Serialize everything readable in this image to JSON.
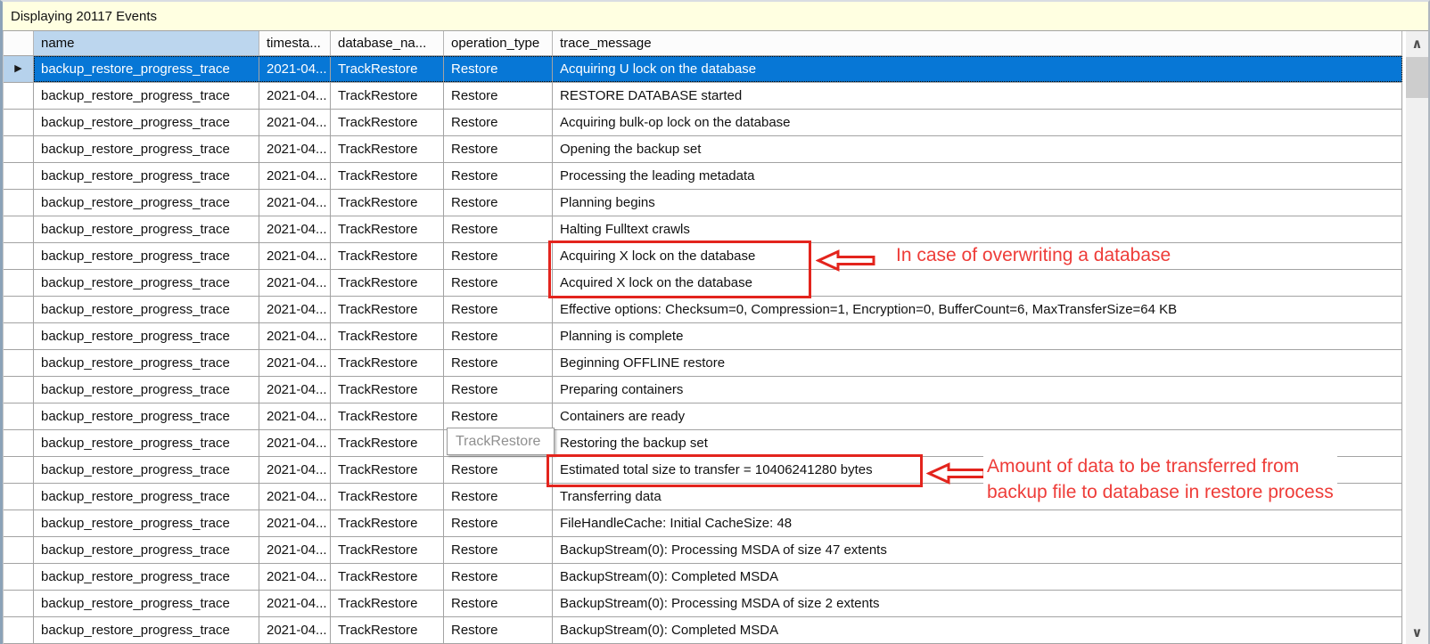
{
  "status_bar": {
    "text": "Displaying 20117 Events"
  },
  "grid": {
    "columns": [
      {
        "label": "name"
      },
      {
        "label": "timesta..."
      },
      {
        "label": "database_na..."
      },
      {
        "label": "operation_type"
      },
      {
        "label": "trace_message"
      }
    ],
    "row_marker_icon": "▶",
    "rows": [
      {
        "selected": true,
        "name": "backup_restore_progress_trace",
        "timestamp": "2021-04...",
        "database_name": "TrackRestore",
        "operation_type": "Restore",
        "trace_message": "Acquiring U lock on the database"
      },
      {
        "name": "backup_restore_progress_trace",
        "timestamp": "2021-04...",
        "database_name": "TrackRestore",
        "operation_type": "Restore",
        "trace_message": "RESTORE DATABASE started"
      },
      {
        "name": "backup_restore_progress_trace",
        "timestamp": "2021-04...",
        "database_name": "TrackRestore",
        "operation_type": "Restore",
        "trace_message": "Acquiring bulk-op lock on the database"
      },
      {
        "name": "backup_restore_progress_trace",
        "timestamp": "2021-04...",
        "database_name": "TrackRestore",
        "operation_type": "Restore",
        "trace_message": "Opening the backup set"
      },
      {
        "name": "backup_restore_progress_trace",
        "timestamp": "2021-04...",
        "database_name": "TrackRestore",
        "operation_type": "Restore",
        "trace_message": "Processing the leading metadata"
      },
      {
        "name": "backup_restore_progress_trace",
        "timestamp": "2021-04...",
        "database_name": "TrackRestore",
        "operation_type": "Restore",
        "trace_message": "Planning begins"
      },
      {
        "name": "backup_restore_progress_trace",
        "timestamp": "2021-04...",
        "database_name": "TrackRestore",
        "operation_type": "Restore",
        "trace_message": "Halting Fulltext crawls"
      },
      {
        "name": "backup_restore_progress_trace",
        "timestamp": "2021-04...",
        "database_name": "TrackRestore",
        "operation_type": "Restore",
        "trace_message": "Acquiring X lock on the database"
      },
      {
        "name": "backup_restore_progress_trace",
        "timestamp": "2021-04...",
        "database_name": "TrackRestore",
        "operation_type": "Restore",
        "trace_message": "Acquired X lock on the database"
      },
      {
        "name": "backup_restore_progress_trace",
        "timestamp": "2021-04...",
        "database_name": "TrackRestore",
        "operation_type": "Restore",
        "trace_message": "Effective options: Checksum=0, Compression=1, Encryption=0, BufferCount=6, MaxTransferSize=64 KB"
      },
      {
        "name": "backup_restore_progress_trace",
        "timestamp": "2021-04...",
        "database_name": "TrackRestore",
        "operation_type": "Restore",
        "trace_message": "Planning is complete"
      },
      {
        "name": "backup_restore_progress_trace",
        "timestamp": "2021-04...",
        "database_name": "TrackRestore",
        "operation_type": "Restore",
        "trace_message": "Beginning OFFLINE restore"
      },
      {
        "name": "backup_restore_progress_trace",
        "timestamp": "2021-04...",
        "database_name": "TrackRestore",
        "operation_type": "Restore",
        "trace_message": "Preparing containers"
      },
      {
        "name": "backup_restore_progress_trace",
        "timestamp": "2021-04...",
        "database_name": "TrackRestore",
        "operation_type": "Restore",
        "trace_message": "Containers are ready"
      },
      {
        "name": "backup_restore_progress_trace",
        "timestamp": "2021-04...",
        "database_name": "TrackRestore",
        "operation_type": "Restore",
        "trace_message": "Restoring the backup set"
      },
      {
        "name": "backup_restore_progress_trace",
        "timestamp": "2021-04...",
        "database_name": "TrackRestore",
        "operation_type": "Restore",
        "trace_message": "Estimated total size to transfer = 10406241280 bytes"
      },
      {
        "name": "backup_restore_progress_trace",
        "timestamp": "2021-04...",
        "database_name": "TrackRestore",
        "operation_type": "Restore",
        "trace_message": "Transferring data"
      },
      {
        "name": "backup_restore_progress_trace",
        "timestamp": "2021-04...",
        "database_name": "TrackRestore",
        "operation_type": "Restore",
        "trace_message": "FileHandleCache: Initial CacheSize: 48"
      },
      {
        "name": "backup_restore_progress_trace",
        "timestamp": "2021-04...",
        "database_name": "TrackRestore",
        "operation_type": "Restore",
        "trace_message": "BackupStream(0): Processing MSDA of size 47 extents"
      },
      {
        "name": "backup_restore_progress_trace",
        "timestamp": "2021-04...",
        "database_name": "TrackRestore",
        "operation_type": "Restore",
        "trace_message": "BackupStream(0): Completed MSDA"
      },
      {
        "name": "backup_restore_progress_trace",
        "timestamp": "2021-04...",
        "database_name": "TrackRestore",
        "operation_type": "Restore",
        "trace_message": "BackupStream(0): Processing MSDA of size 2 extents"
      },
      {
        "name": "backup_restore_progress_trace",
        "timestamp": "2021-04...",
        "database_name": "TrackRestore",
        "operation_type": "Restore",
        "trace_message": "BackupStream(0): Completed MSDA"
      }
    ]
  },
  "overlay": {
    "tooltip_text": "TrackRestore"
  },
  "annotations": {
    "note1": "In case of overwriting a database",
    "note2_line1": "Amount of data to be transferred from",
    "note2_line2": "backup file to database in restore process"
  },
  "scrollbar": {
    "up_icon": "∧",
    "down_icon": "∨"
  },
  "colors": {
    "selection_blue": "#0777d6",
    "selector_selected": "#b6d2ec",
    "header_highlight": "#bcd6ee",
    "header_bg": "#fcfcfc",
    "status_bar_bg": "#ffffe1",
    "grid_line": "#a3a3a3",
    "annotation_red": "#e3241d",
    "annotation_text_red": "#ee3c38",
    "tooltip_text": "#8f8f8f",
    "tooltip_border": "#9b9b9b",
    "scroll_track": "#f0f0f0",
    "scroll_thumb": "#cdcdcd",
    "scroll_arrow": "#505050",
    "window_border": "#8ba2b8"
  }
}
